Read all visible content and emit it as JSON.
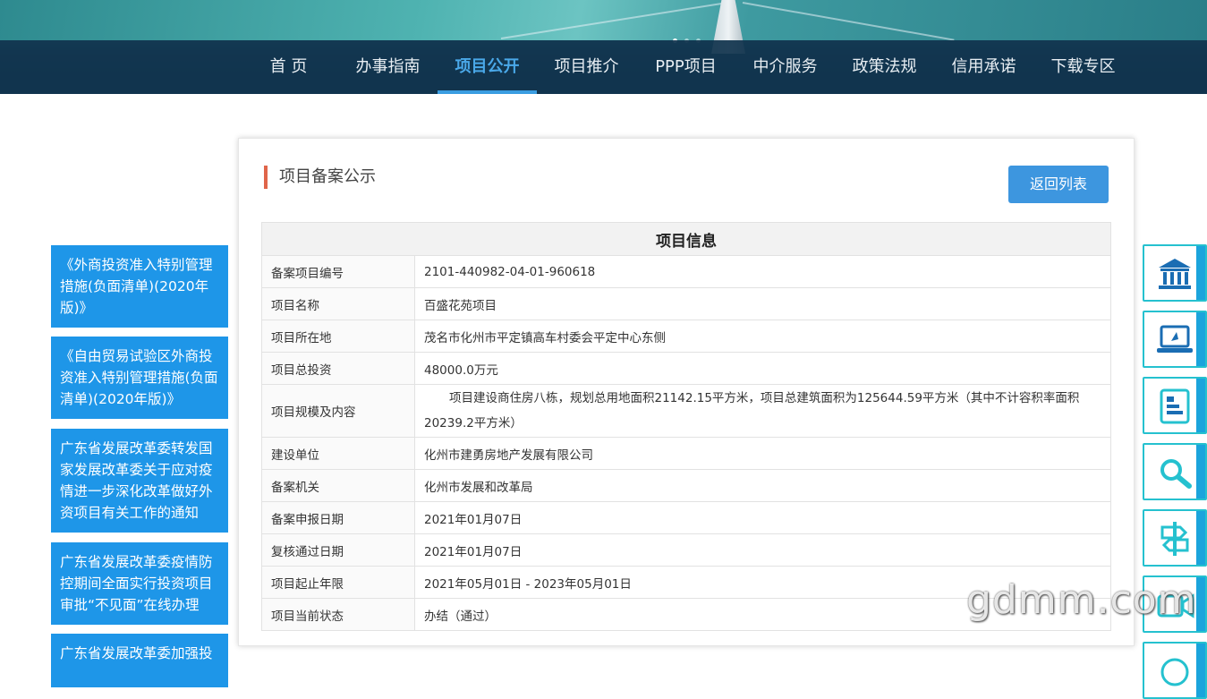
{
  "nav": {
    "items": [
      "首 页",
      "办事指南",
      "项目公开",
      "项目推介",
      "PPP项目",
      "中介服务",
      "政策法规",
      "信用承诺",
      "下载专区"
    ],
    "active": "项目公开"
  },
  "sidebar": {
    "links": [
      "《外商投资准入特别管理措施(负面清单)(2020年版)》",
      "《自由贸易试验区外商投资准入特别管理措施(负面清单)(2020年版)》",
      "广东省发展改革委转发国家发展改革委关于应对疫情进一步深化改革做好外资项目有关工作的通知",
      "广东省发展改革委疫情防控期间全面实行投资项目审批“不见面”在线办理",
      "广东省发展改革委加强投"
    ]
  },
  "card": {
    "title": "项目备案公示",
    "back_button": "返回列表",
    "table_header": "项目信息",
    "rows": [
      {
        "k": "备案项目编号",
        "v": "2101-440982-04-01-960618"
      },
      {
        "k": "项目名称",
        "v": "百盛花苑项目"
      },
      {
        "k": "项目所在地",
        "v": "茂名市化州市平定镇高车村委会平定中心东侧"
      },
      {
        "k": "项目总投资",
        "v": "48000.0万元"
      },
      {
        "k": "项目规模及内容",
        "v": "项目建设商住房八栋，规划总用地面积21142.15平方米，项目总建筑面积为125644.59平方米（其中不计容积率面积20239.2平方米）"
      },
      {
        "k": "建设单位",
        "v": "化州市建勇房地产发展有限公司"
      },
      {
        "k": "备案机关",
        "v": "化州市发展和改革局"
      },
      {
        "k": "备案申报日期",
        "v": "2021年01月07日"
      },
      {
        "k": "复核通过日期",
        "v": "2021年01月07日"
      },
      {
        "k": "项目起止年限",
        "v": "2021年05月01日 - 2023年05月01日"
      },
      {
        "k": "项目当前状态",
        "v": "办结（通过）"
      }
    ]
  },
  "tools": {
    "edge_labels": [
      "",
      "",
      "",
      "",
      "",
      ""
    ]
  },
  "watermark": "gdmm.com",
  "colors": {
    "nav_bg": "#11344e",
    "accent": "#3a9de1",
    "sidebar_link_bg": "#1e96e8",
    "title_marker": "#e0654a",
    "tool_border": "#25c1cf"
  }
}
